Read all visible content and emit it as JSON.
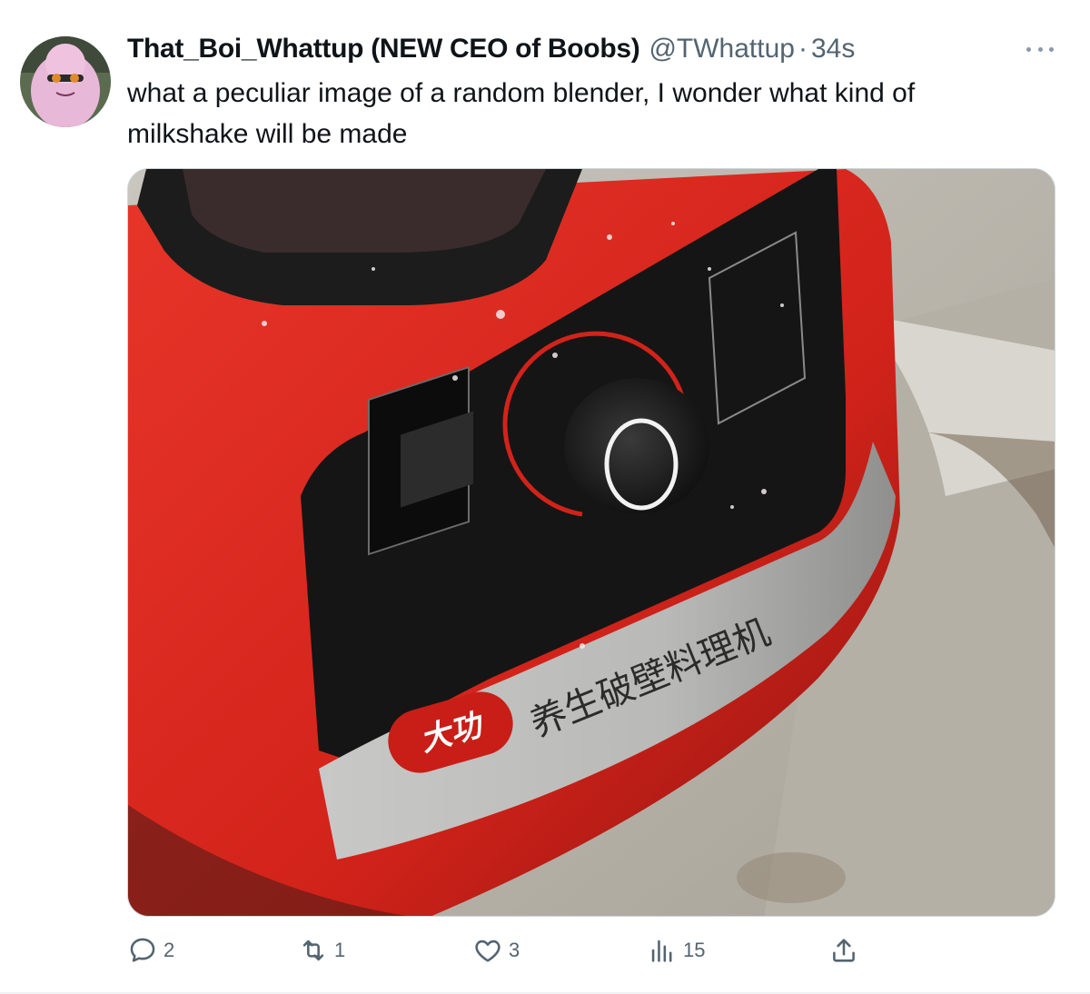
{
  "tweet": {
    "display_name": "That_Boi_Whattup (NEW CEO of Boobs)",
    "handle": "@TWhattup",
    "separator": "·",
    "time": "34s",
    "text": "what a peculiar image of a random blender, I wonder what kind of milkshake will be made",
    "avatar_icon": "avatar-image",
    "media_description_icon": "tweet-photo"
  },
  "actions": {
    "reply": {
      "icon": "reply-bubble-icon",
      "count": "2"
    },
    "retweet": {
      "icon": "retweet-icon",
      "count": "1"
    },
    "like": {
      "icon": "heart-icon",
      "count": "3"
    },
    "views": {
      "icon": "views-bar-icon",
      "count": "15"
    },
    "share": {
      "icon": "share-upload-icon"
    }
  },
  "colors": {
    "text_primary": "#0f1419",
    "text_secondary": "#536471",
    "border": "#cfd9de",
    "blender_red": "#d7261c"
  }
}
